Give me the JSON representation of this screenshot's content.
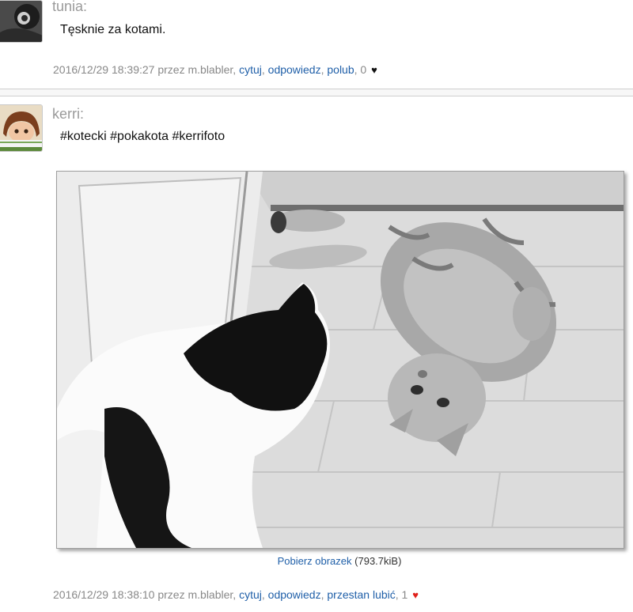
{
  "posts": [
    {
      "username": "tunia:",
      "text": "Tęsknie za kotami.",
      "timestamp": "2016/12/29 18:39:27",
      "by": "przez m.blabler,",
      "actions": [
        "cytuj",
        "odpowiedz",
        "polub"
      ],
      "likes": "0",
      "heart_color": "#111111"
    },
    {
      "username": "kerri:",
      "tags": [
        "#kotecki",
        "#pokakota",
        "#kerrifoto"
      ],
      "image": {
        "download_label": "Pobierz obrazek",
        "size": "(793.7kiB)"
      },
      "timestamp": "2016/12/29 18:38:10",
      "by": "przez m.blabler,",
      "actions": [
        "cytuj",
        "odpowiedz",
        "przestan lubić"
      ],
      "likes": "1",
      "heart_color": "#e0211b"
    }
  ]
}
